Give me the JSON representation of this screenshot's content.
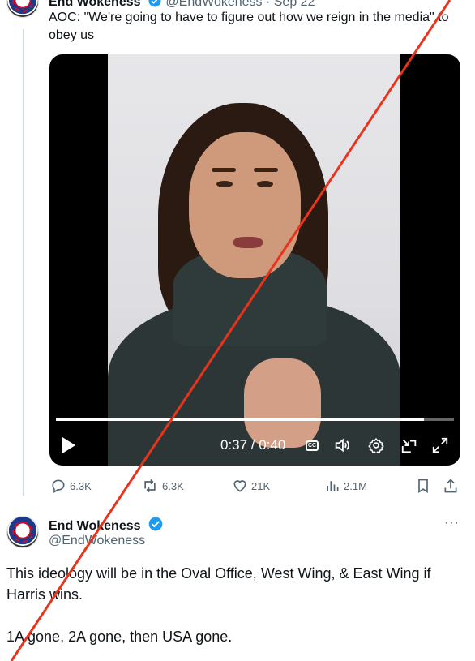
{
  "top_tweet": {
    "author_name": "End Wokeness",
    "handle_time": "@EndWokeness · Sep 22",
    "text": "AOC: \"We're going to have to figure out how we reign in the media\" to obey us",
    "video": {
      "time_label": "0:37 / 0:40",
      "progress": 0.925,
      "cc_label": "CC"
    },
    "actions": {
      "replies": "6.3K",
      "reposts": "6.3K",
      "likes": "21K",
      "views": "2.1M"
    }
  },
  "second_tweet": {
    "author_name": "End Wokeness",
    "handle": "@EndWokeness",
    "more": "···",
    "paragraph_1": "This ideology will be in the Oval Office, West Wing, & East Wing if Harris wins.",
    "paragraph_2": "1A gone, 2A gone, then USA gone."
  },
  "colors": {
    "accent_blue": "#1d9bf0",
    "secondary_text": "#536471",
    "overlay_line": "#e8341c"
  }
}
